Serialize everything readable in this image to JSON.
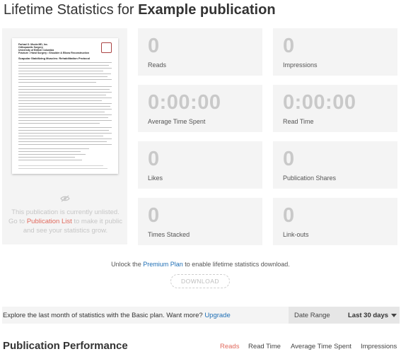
{
  "header": {
    "title_prefix": "Lifetime Statistics for ",
    "title_name": "Example publication"
  },
  "cover": {
    "doc_header": "Farhad O. Moola MD, Inc.\nOrthopaedic Surgery\nUniversity of British Columbia\nFracture • Hand Surgery • Shoulder & Elbow Reconstruction",
    "doc_title": "Scapular Stabilizing Muscles: Rehabilitation Protocol",
    "unlisted_line1": "This publication is currently unlisted.",
    "unlisted_go": "Go to ",
    "unlisted_link": "Publication List",
    "unlisted_rest": " to make it public and see your statistics grow."
  },
  "stats": [
    {
      "value": "0",
      "label": "Reads"
    },
    {
      "value": "0",
      "label": "Impressions"
    },
    {
      "value": "0:00:00",
      "label": "Average Time Spent"
    },
    {
      "value": "0:00:00",
      "label": "Read Time"
    },
    {
      "value": "0",
      "label": "Likes"
    },
    {
      "value": "0",
      "label": "Publication Shares"
    },
    {
      "value": "0",
      "label": "Times Stacked"
    },
    {
      "value": "0",
      "label": "Link-outs"
    }
  ],
  "premium": {
    "prefix": "Unlock the ",
    "plan_link": "Premium Plan",
    "suffix": " to enable lifetime statistics download.",
    "download_label": "DOWNLOAD"
  },
  "basic_bar": {
    "text": "Explore the last month of statistics with the Basic plan. Want more? ",
    "upgrade_link": "Upgrade",
    "date_range_label": "Date Range",
    "date_range_value": "Last 30 days"
  },
  "performance": {
    "title": "Publication Performance",
    "tabs": [
      "Reads",
      "Read Time",
      "Average Time Spent",
      "Impressions"
    ]
  },
  "colors": {
    "accent_red": "#e16a5e",
    "link_blue": "#1f6fb5",
    "card_bg": "#f4f4f4",
    "stat_number": "#c9c9c9"
  }
}
